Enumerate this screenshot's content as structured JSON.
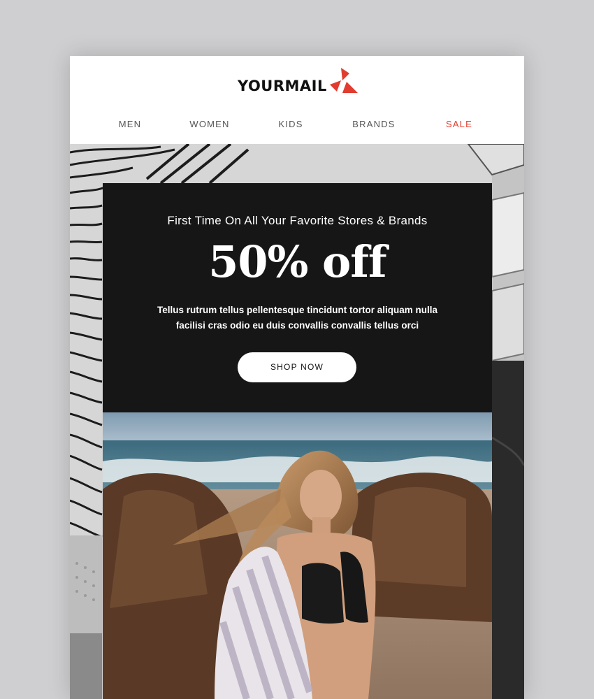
{
  "brand": {
    "name": "YOURMAIL",
    "accent_color": "#e03c2f"
  },
  "nav": {
    "items": [
      {
        "label": "MEN"
      },
      {
        "label": "WOMEN"
      },
      {
        "label": "KIDS"
      },
      {
        "label": "BRANDS"
      },
      {
        "label": "SALE"
      }
    ]
  },
  "promo": {
    "subtitle": "First Time On All Your Favorite Stores & Brands",
    "headline": "50% off",
    "body_line1": "Tellus rutrum tellus pellentesque tincidunt tortor aliquam nulla",
    "body_line2": "facilisi cras odio eu duis convallis convallis tellus orci",
    "button_label": "SHOP NOW"
  },
  "hero_image": {
    "icon": "beach-photo"
  }
}
